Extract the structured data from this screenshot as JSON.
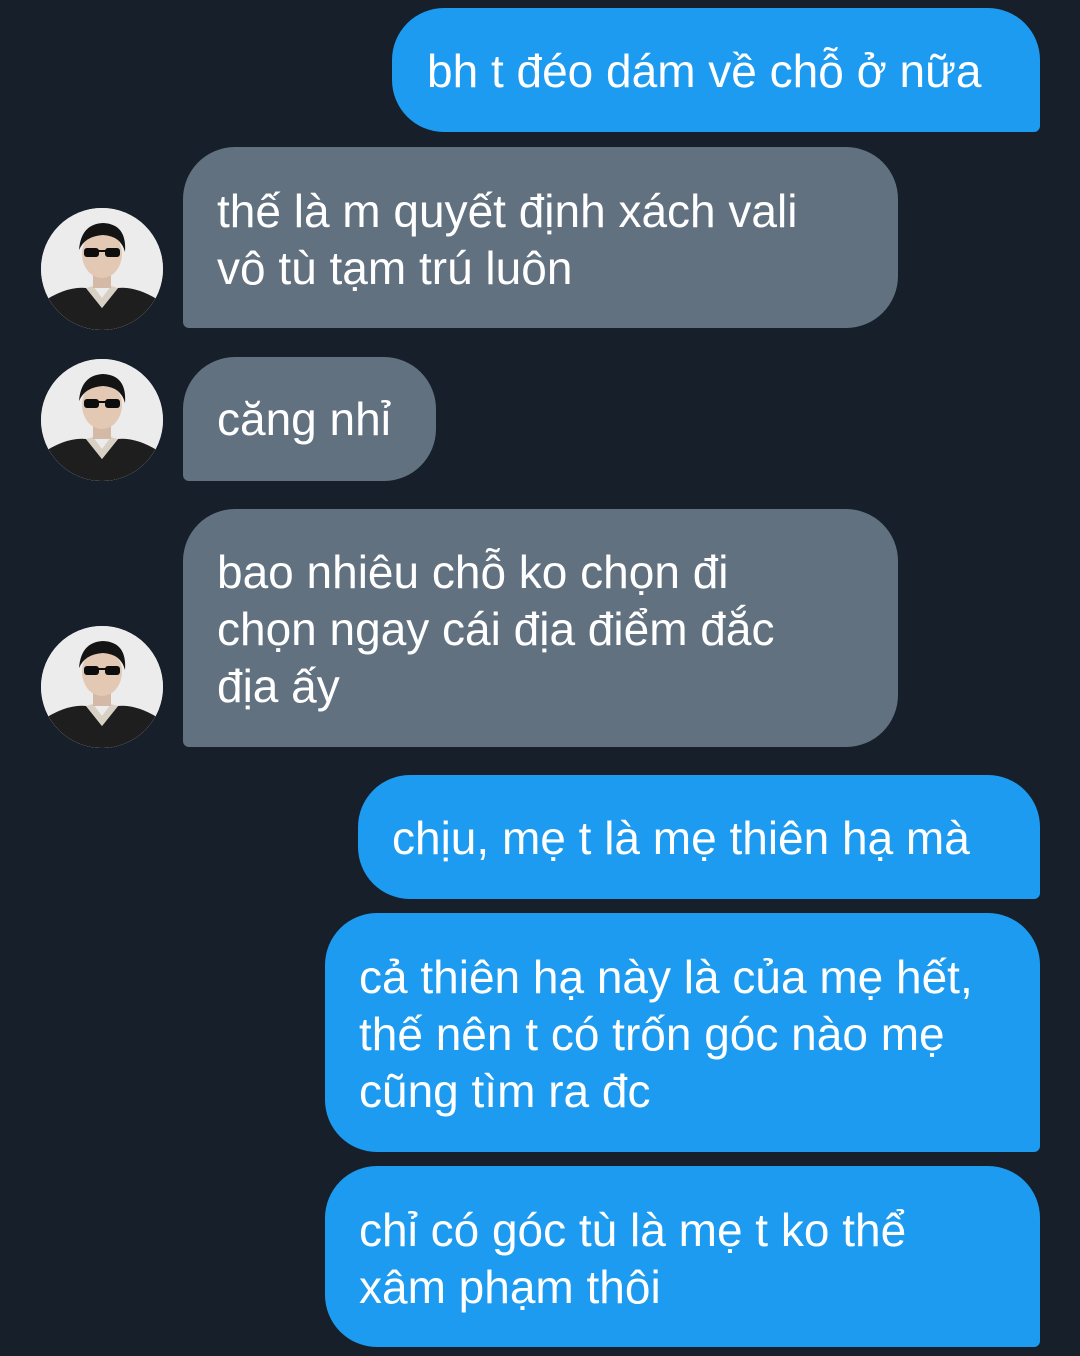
{
  "colors": {
    "background": "#161f2a",
    "sent_bubble": "#1d9bf0",
    "received_bubble": "#627180",
    "text": "#ffffff"
  },
  "contact": {
    "avatar_icon": "profile-photo-man-sunglasses"
  },
  "messages": [
    {
      "direction": "sent",
      "text": "bh t đéo dám về chỗ ở nữa"
    },
    {
      "direction": "received",
      "text": "thế là m quyết định xách vali\nvô tù tạm trú luôn"
    },
    {
      "direction": "received",
      "text": "căng nhỉ"
    },
    {
      "direction": "received",
      "text": "bao nhiêu chỗ ko chọn đi\nchọn ngay cái địa điểm đắc\nđịa ấy"
    },
    {
      "direction": "sent",
      "text": "chịu, mẹ t là mẹ thiên hạ mà"
    },
    {
      "direction": "sent",
      "text": "cả thiên hạ này là của mẹ hết,\nthế nên t có trốn góc nào mẹ\ncũng tìm ra đc"
    },
    {
      "direction": "sent",
      "text": "chỉ có góc tù là mẹ t ko thể\nxâm phạm thôi"
    }
  ]
}
